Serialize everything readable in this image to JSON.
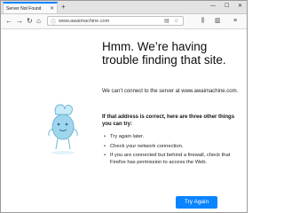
{
  "tab": {
    "title": "Server Not Found",
    "close_icon": "✕"
  },
  "toolbar": {
    "new_tab_icon": "+",
    "minimize_icon": "—",
    "maximize_icon": "☐",
    "close_icon": "✕",
    "back_icon": "←",
    "forward_icon": "→",
    "reload_icon": "↻",
    "home_icon": "⌂",
    "url": "www.awaimachine.com",
    "info_icon": "ⓘ",
    "reader_icon": "▤",
    "bookmark_icon": "☆",
    "library_icon": "⫼",
    "sidebar_icon": "▥",
    "menu_icon": "≡"
  },
  "error": {
    "title": "Hmm. We’re having trouble finding that site.",
    "description": "We can’t connect to the server at www.awaimachine.com.",
    "subheading": "If that address is correct, here are three other things you can try:",
    "suggestions": [
      "Try again later.",
      "Check your network connection.",
      "If you are connected but behind a firewall, check that Firefox has permission to access the Web."
    ],
    "button_label": "Try Again"
  },
  "colors": {
    "accent": "#0a84ff",
    "text": "#0c0c0d",
    "illustration": "#9fd6ee"
  }
}
